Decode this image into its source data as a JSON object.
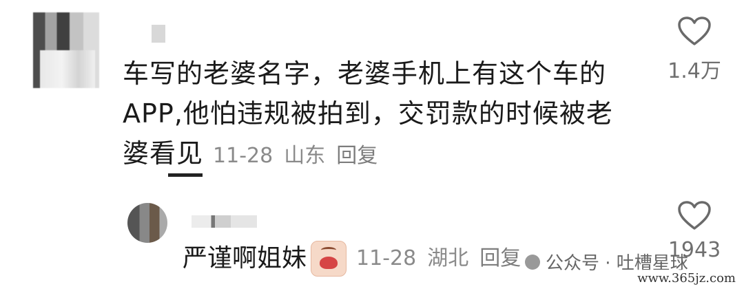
{
  "comment": {
    "text": "车写的老婆名字，老婆手机上有这个车的APP,他怕违规被拍到，交罚款的时候被老婆看见",
    "date": "11-28",
    "location": "山东",
    "reply_label": "回复",
    "likes": "1.4万"
  },
  "reply": {
    "text": "严谨啊姐妹",
    "emoji": "crying-face-sticker",
    "date": "11-28",
    "location": "湖北",
    "reply_label": "回复",
    "likes": "1943"
  },
  "watermark": {
    "text": "公众号 · 吐槽星球"
  },
  "site_url": "www.365jz.com",
  "colors": {
    "meta_text": "#8a8a8a",
    "body_text": "#1a1a1a"
  }
}
